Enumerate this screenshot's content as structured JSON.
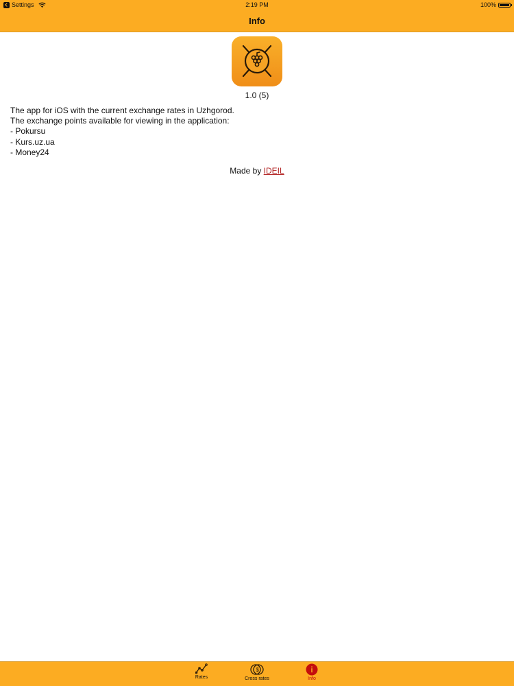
{
  "status_bar": {
    "back_app": "Settings",
    "time": "2:19 PM",
    "battery": "100%"
  },
  "nav": {
    "title": "Info"
  },
  "about": {
    "version": "1.0 (5)",
    "description_lines": [
      "The app for iOS with the current exchange rates in Uzhgorod.",
      "The exchange points available for viewing in the application:",
      "- Pokursu",
      "- Kurs.uz.ua",
      "- Money24"
    ],
    "made_by_prefix": "Made by",
    "made_by_link": "IDEIL"
  },
  "tab_bar": {
    "tabs": [
      {
        "label": "Rates",
        "icon": "line-chart-icon",
        "active": false
      },
      {
        "label": "Cross rates",
        "icon": "coins-exchange-icon",
        "active": false
      },
      {
        "label": "Info",
        "icon": "info-icon",
        "active": true
      }
    ]
  },
  "colors": {
    "accent": "#FCAC22",
    "link": "#B22222",
    "active_tab": "#C40D0D"
  }
}
